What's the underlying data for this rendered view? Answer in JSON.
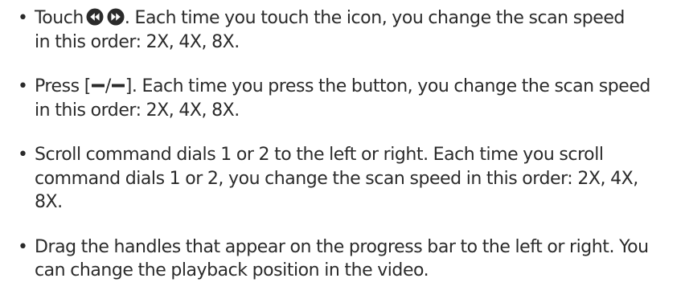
{
  "items": [
    {
      "bullet": "•",
      "text_before_icons": "Touch",
      "icons": [
        "rewind-icon",
        "fast-forward-icon"
      ],
      "text_after_icons": ". Each time you touch the icon, you change the scan speed",
      "line2": "in this order: 2X, 4X, 8X."
    },
    {
      "bullet": "•",
      "text_before": "Press [",
      "separator": "/",
      "text_after": "]. Each time you press the button, you change the scan speed",
      "buttons": [
        "minus-button-icon",
        "minus-button-icon"
      ],
      "line2": "in this order: 2X, 4X, 8X."
    },
    {
      "bullet": "•",
      "line1": "Scroll command dials 1 or 2 to the left or right. Each time you scroll",
      "line2": "command dials 1 or 2, you change the scan speed in this order: 2X, 4X,",
      "line3": "8X."
    },
    {
      "bullet": "•",
      "line1": "Drag the handles that appear on the progress bar to the left or right. You",
      "line2": "can change the playback position in the video."
    }
  ],
  "colors": {
    "text": "#2b2b2b",
    "icon": "#2b2b2b"
  }
}
